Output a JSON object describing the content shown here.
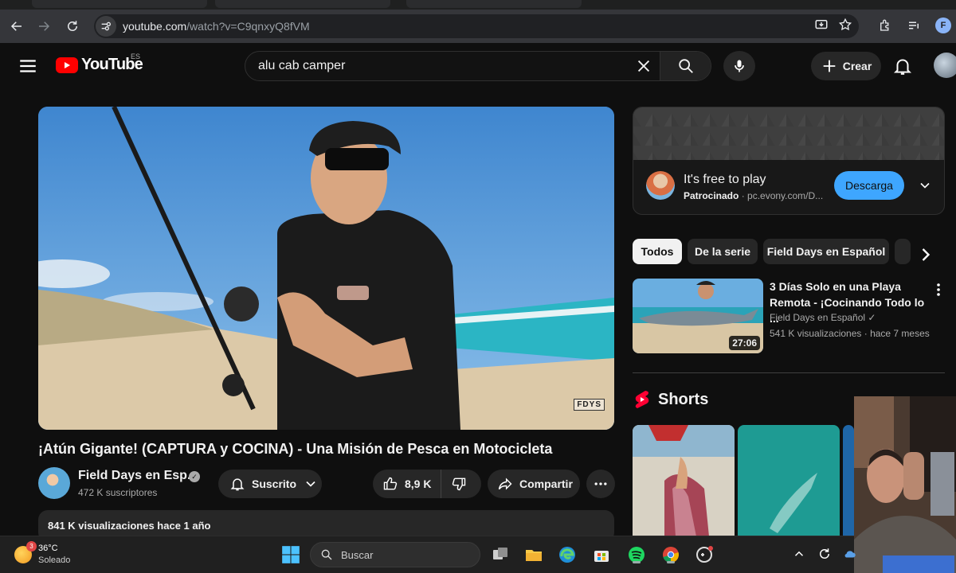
{
  "browser": {
    "url_host": "youtube.com",
    "url_path": "/watch?v=C9qnxyQ8fVM",
    "profile_initial": "F"
  },
  "header": {
    "logo_text": "YouTube",
    "country_code": "ES",
    "search_query": "alu cab camper",
    "create_label": "Crear"
  },
  "video": {
    "title": "¡Atún Gigante! (CAPTURA y COCINA) - Una Misión de Pesca en Motocicleta",
    "watermark": "FDYS",
    "channel_name": "Field Days en Esp...",
    "subscribers": "472 K suscriptores",
    "subscribed_label": "Suscrito",
    "likes": "8,9 K",
    "share_label": "Compartir",
    "description_stats": "841 K visualizaciones  hace 1 año"
  },
  "ad": {
    "title": "It's free to play",
    "sponsored_label": "Patrocinado",
    "domain": "pc.evony.com/D...",
    "cta_label": "Descarga"
  },
  "chips": [
    {
      "label": "Todos",
      "active": true
    },
    {
      "label": "De la serie",
      "active": false
    },
    {
      "label": "Field Days en Español",
      "active": false
    }
  ],
  "recommendation": {
    "title": "3 Días Solo en una Playa Remota - ¡Cocinando Todo lo ...",
    "channel": "Field Days en Español",
    "meta": "541 K visualizaciones · hace 7 meses",
    "duration": "27:06"
  },
  "shorts": {
    "heading": "Shorts"
  },
  "taskbar": {
    "temperature": "36°C",
    "condition": "Soleado",
    "notification_count": "3",
    "search_label": "Buscar"
  },
  "colors": {
    "youtube_red": "#ff0000",
    "cta_blue": "#3ea6ff",
    "background": "#0f0f0f",
    "surface": "#272727"
  }
}
